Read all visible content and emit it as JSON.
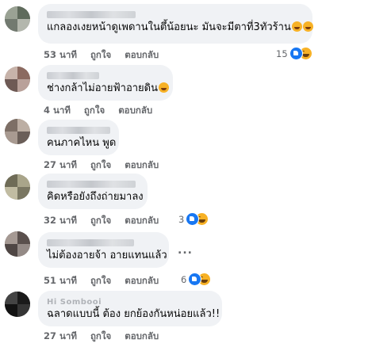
{
  "comments": [
    {
      "text": "แกลองเงยหน้าดูเพดานในตึ้น้อยนะ มันจะมีตาที่3ทัวร้าน",
      "time": "53 นาที",
      "like": "ถูกใจ",
      "reply": "ตอบกลับ",
      "reactions": "15",
      "emoji": [
        "laughing-rolling-emoji",
        "laughing-rolling-emoji"
      ]
    },
    {
      "text": "ช่างกล้าไม่อายฟ้าอายดิน",
      "time": "4 นาที",
      "like": "ถูกใจ",
      "reply": "ตอบกลับ",
      "reactions": "",
      "emoji": [
        "laughing-emoji"
      ]
    },
    {
      "text": "คนภาคไหน พูด",
      "time": "27 นาที",
      "like": "ถูกใจ",
      "reply": "ตอบกลับ",
      "reactions": ""
    },
    {
      "text": "คิดหรือยังถึงถ่ายมาลง",
      "time": "32 นาที",
      "like": "ถูกใจ",
      "reply": "ตอบกลับ",
      "reactions": "3"
    },
    {
      "text": "ไม่ต้องอายจ้า อายแทนแล้ว",
      "time": "51 นาที",
      "like": "ถูกใจ",
      "reply": "ตอบกลับ",
      "reactions": "6",
      "more": "..."
    },
    {
      "name_visible": "Hi Sombooi",
      "text": "ฉลาดแบบนี้ ต้อง ยกย้องกันหน่อยแล้ว!!",
      "time": "27 นาที",
      "like": "ถูกใจ",
      "reply": "ตอบกลับ",
      "reactions": ""
    }
  ],
  "colors": {
    "bubble": "#f0f2f5",
    "meta": "#65676b",
    "like_reaction": "#1877f2",
    "haha_reaction": "#f7b125"
  }
}
